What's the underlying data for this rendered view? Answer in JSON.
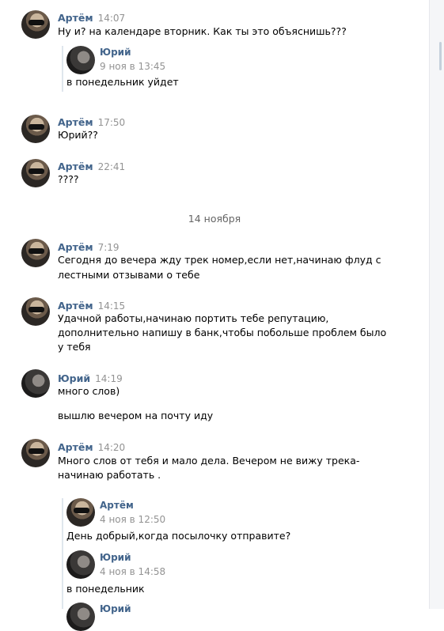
{
  "messages": [
    {
      "author": "Артём",
      "time": "14:07",
      "lines": [
        "Ну и? на календаре вторник. Как ты это объяснишь???"
      ],
      "forward": {
        "author": "Юрий",
        "date": "9 ноя в 13:45",
        "text": "в понедельник уйдет"
      }
    },
    {
      "author": "Артём",
      "time": "17:50",
      "lines": [
        "Юрий??"
      ]
    },
    {
      "author": "Артём",
      "time": "22:41",
      "lines": [
        "????"
      ]
    },
    {
      "author": "Артём",
      "time": "7:19",
      "lines": [
        "Сегодня до вечера жду трек номер,если нет,начинаю флуд с",
        "лестными отзывами о тебе"
      ]
    },
    {
      "author": "Артём",
      "time": "14:15",
      "lines": [
        "Удачной работы,начинаю портить тебе репутацию,",
        "дополнительно напишу в банк,чтобы побольше проблем было",
        "у тебя"
      ]
    },
    {
      "author": "Юрий",
      "time": "14:19",
      "lines": [
        "много слов)"
      ],
      "extra": "вышлю вечером на почту иду"
    },
    {
      "author": "Артём",
      "time": "14:20",
      "lines": [
        "Много слов от тебя и мало дела. Вечером не вижу трека-",
        "начинаю работать ."
      ],
      "forwards": [
        {
          "author": "Артём",
          "date": "4 ноя в 12:50",
          "text": "День добрый,когда посылочку отправите?"
        },
        {
          "author": "Юрий",
          "date": "4 ноя в 14:58",
          "text": "в понедельник"
        },
        {
          "author": "Юрий"
        }
      ]
    }
  ],
  "date_separator": "14 ноября"
}
